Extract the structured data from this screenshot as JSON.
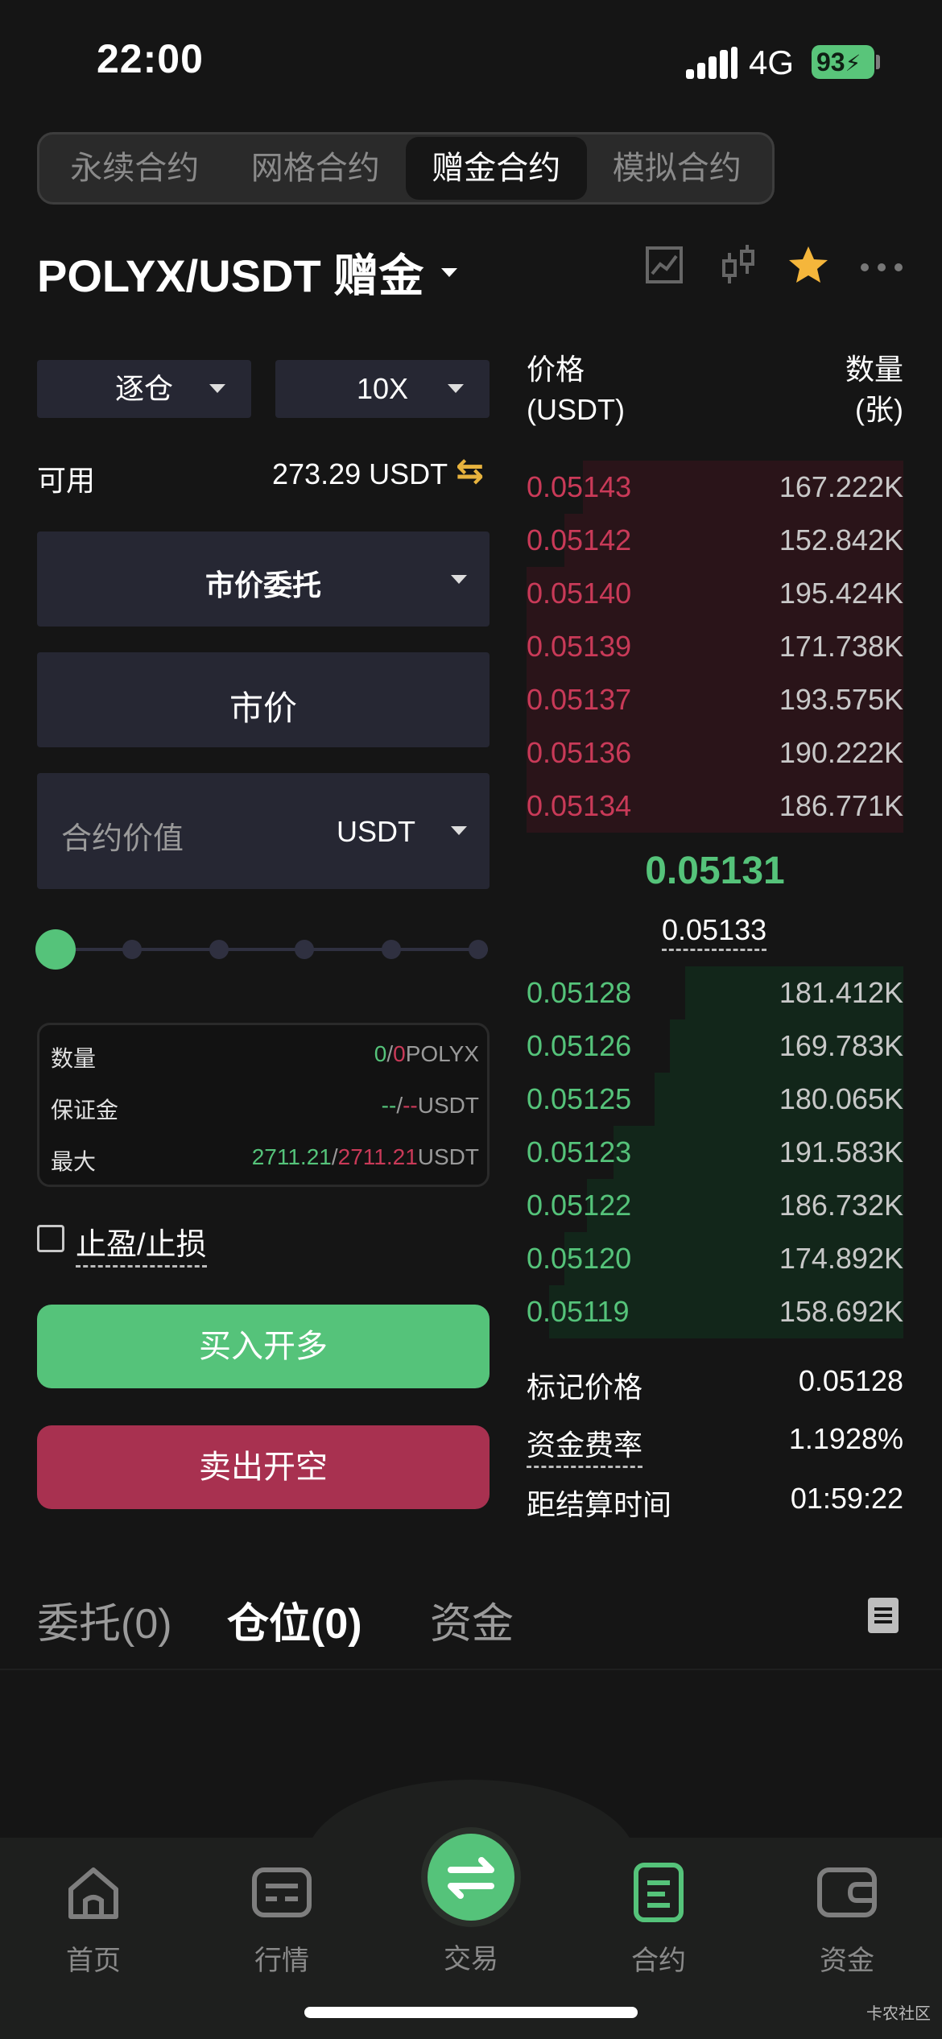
{
  "status": {
    "time": "22:00",
    "network": "4G",
    "battery": "93"
  },
  "contract_tabs": [
    "永续合约",
    "网格合约",
    "赠金合约",
    "模拟合约"
  ],
  "active_contract_tab": 2,
  "pair": {
    "name": "POLYX/USDT 赠金"
  },
  "header_icons": [
    "chart-line-icon",
    "candlestick-icon",
    "star-icon",
    "more-icon"
  ],
  "order_form": {
    "margin_mode": "逐仓",
    "leverage": "10X",
    "available_label": "可用",
    "available_value": "273.29 USDT",
    "order_type": "市价委托",
    "price_mode": "市价",
    "amount_placeholder": "合约价值",
    "amount_unit": "USDT",
    "slider_percent": 0
  },
  "info": {
    "qty_label": "数量",
    "qty_a": "0",
    "qty_sep": "/",
    "qty_b": "0",
    "qty_unit": "POLYX",
    "margin_label": "保证金",
    "margin_a": "--",
    "margin_sep": "/",
    "margin_b": "--",
    "margin_unit": "USDT",
    "max_label": "最大",
    "max_a": "2711.21",
    "max_sep": "/",
    "max_b": "2711.21",
    "max_unit": "USDT"
  },
  "tpsl_label": "止盈/止损",
  "buy_label": "买入开多",
  "sell_label": "卖出开空",
  "colors": {
    "green": "#55c37a",
    "red": "#c93a58",
    "gold": "#e8b33e"
  },
  "orderbook": {
    "price_header": "价格",
    "price_unit": "(USDT)",
    "qty_header": "数量",
    "qty_unit": "(张)",
    "asks": [
      {
        "price": "0.05143",
        "qty": "167.222K",
        "depth": 0.85
      },
      {
        "price": "0.05142",
        "qty": "152.842K",
        "depth": 0.9
      },
      {
        "price": "0.05140",
        "qty": "195.424K",
        "depth": 1.0
      },
      {
        "price": "0.05139",
        "qty": "171.738K",
        "depth": 1.0
      },
      {
        "price": "0.05137",
        "qty": "193.575K",
        "depth": 1.0
      },
      {
        "price": "0.05136",
        "qty": "190.222K",
        "depth": 1.0
      },
      {
        "price": "0.05134",
        "qty": "186.771K",
        "depth": 1.0
      }
    ],
    "last_price": "0.05131",
    "mark_price": "0.05133",
    "bids": [
      {
        "price": "0.05128",
        "qty": "181.412K",
        "depth": 0.58
      },
      {
        "price": "0.05126",
        "qty": "169.783K",
        "depth": 0.62
      },
      {
        "price": "0.05125",
        "qty": "180.065K",
        "depth": 0.66
      },
      {
        "price": "0.05123",
        "qty": "191.583K",
        "depth": 0.77
      },
      {
        "price": "0.05122",
        "qty": "186.732K",
        "depth": 0.84
      },
      {
        "price": "0.05120",
        "qty": "174.892K",
        "depth": 0.9
      },
      {
        "price": "0.05119",
        "qty": "158.692K",
        "depth": 0.94
      }
    ]
  },
  "stats": [
    {
      "label": "标记价格",
      "value": "0.05128"
    },
    {
      "label": "资金费率",
      "value": "1.1928%"
    },
    {
      "label": "距结算时间",
      "value": "01:59:22"
    }
  ],
  "bottom_tabs": [
    "委托(0)",
    "仓位(0)",
    "资金"
  ],
  "active_bottom_tab": 1,
  "nav": [
    {
      "label": "首页",
      "icon": "home-icon"
    },
    {
      "label": "行情",
      "icon": "market-icon"
    },
    {
      "label": "交易",
      "icon": "trade-swap-icon"
    },
    {
      "label": "合约",
      "icon": "contract-icon"
    },
    {
      "label": "资金",
      "icon": "wallet-icon"
    }
  ],
  "active_nav": 3,
  "watermark": "卡农社区"
}
